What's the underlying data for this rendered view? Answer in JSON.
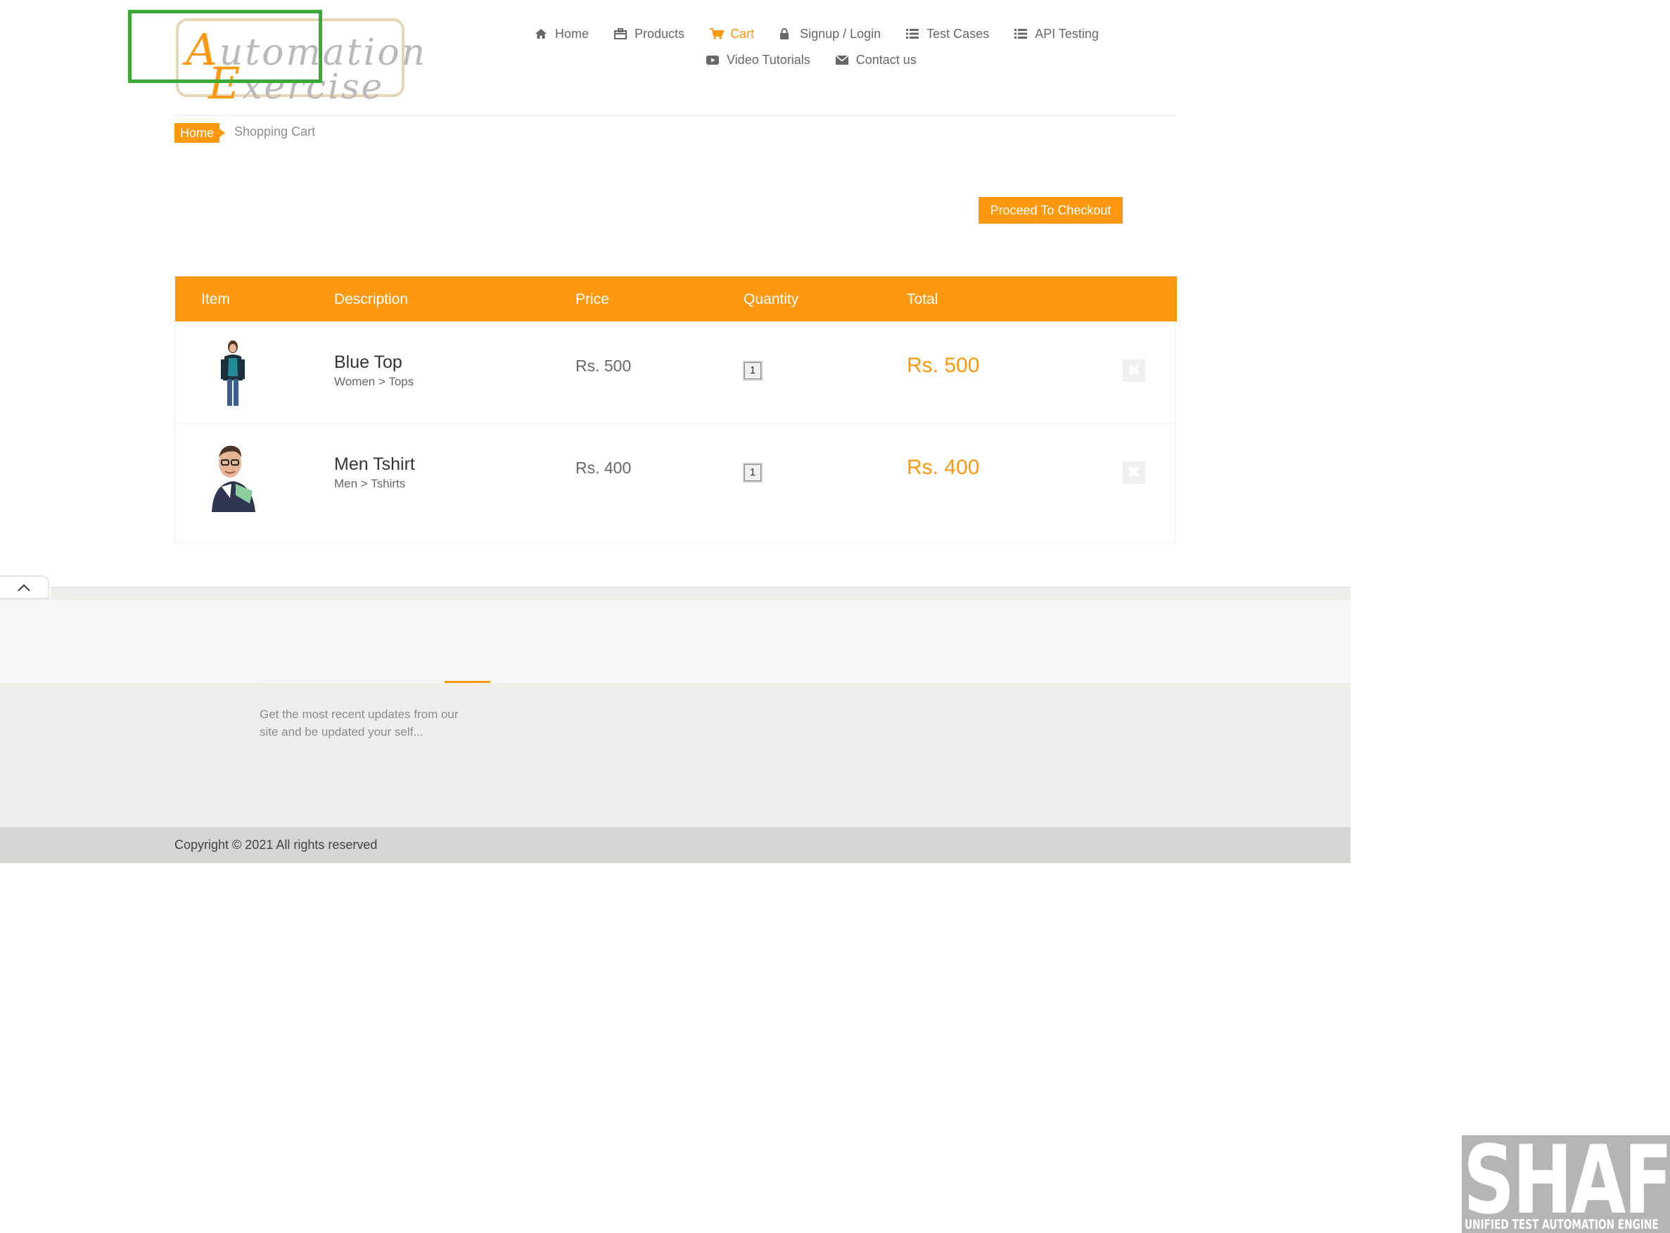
{
  "logo": {
    "line1_cap": "A",
    "line1_rest": "utomation",
    "line2_cap": "E",
    "line2_rest": "xercise"
  },
  "nav": [
    {
      "label": "Home",
      "icon": "home-icon"
    },
    {
      "label": "Products",
      "icon": "products-icon"
    },
    {
      "label": "Cart",
      "icon": "cart-icon",
      "active": true
    },
    {
      "label": "Signup / Login",
      "icon": "lock-icon"
    },
    {
      "label": "Test Cases",
      "icon": "list-icon"
    },
    {
      "label": "API Testing",
      "icon": "list-icon"
    },
    {
      "label": "Video Tutorials",
      "icon": "youtube-icon"
    },
    {
      "label": "Contact us",
      "icon": "envelope-icon"
    }
  ],
  "breadcrumb": {
    "home": "Home",
    "current": "Shopping Cart"
  },
  "checkout_button": "Proceed To Checkout",
  "cart": {
    "headers": [
      "Item",
      "Description",
      "Price",
      "Quantity",
      "Total"
    ],
    "rows": [
      {
        "name": "Blue Top",
        "category": "Women > Tops",
        "price": "Rs. 500",
        "quantity": "1",
        "total": "Rs. 500"
      },
      {
        "name": "Men Tshirt",
        "category": "Men > Tshirts",
        "price": "Rs. 400",
        "quantity": "1",
        "total": "Rs. 400"
      }
    ]
  },
  "footer": {
    "subscription_text": "Get the most recent updates from our site and be updated your self...",
    "copyright": "Copyright © 2021 All rights reserved"
  },
  "watermark": {
    "big": "SHAFT",
    "small": "UNIFIED TEST AUTOMATION ENGINE"
  },
  "colors": {
    "accent": "#fe980f",
    "highlight": "#3aa935",
    "footer_bg": "#efeee8",
    "footer_bottom": "#d6d6d0"
  }
}
